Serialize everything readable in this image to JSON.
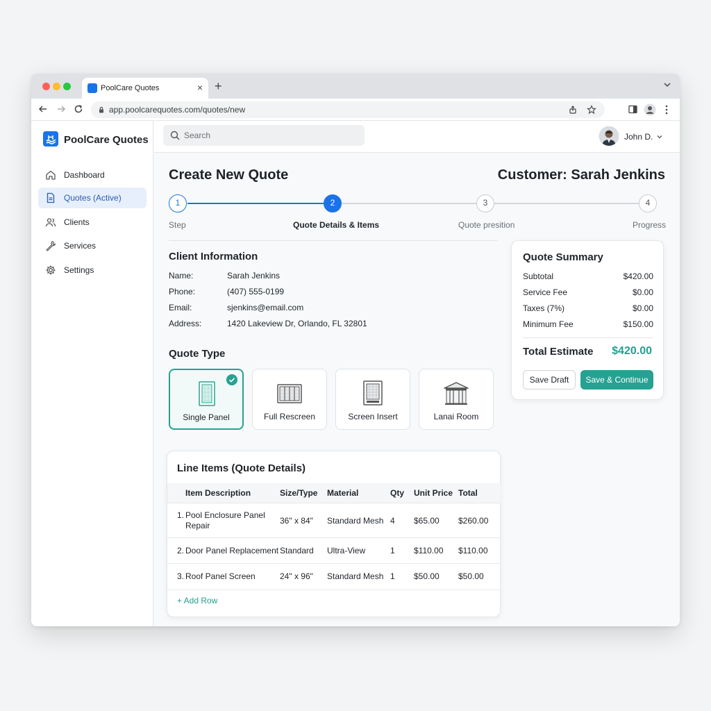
{
  "browser": {
    "tab_title": "PoolCare Quotes",
    "new_tab": "+",
    "url": "app.poolcarequotes.com/quotes/new"
  },
  "sidebar": {
    "brand": "PoolCare Quotes",
    "items": [
      {
        "label": "Dashboard",
        "icon": "home-icon"
      },
      {
        "label": "Quotes (Active)",
        "icon": "document-icon",
        "active": true
      },
      {
        "label": "Clients",
        "icon": "users-icon"
      },
      {
        "label": "Services",
        "icon": "wrench-icon"
      },
      {
        "label": "Settings",
        "icon": "gear-icon"
      }
    ]
  },
  "topbar": {
    "search_placeholder": "Search",
    "user_name": "John D."
  },
  "page": {
    "title": "Create New Quote",
    "customer": "Customer: Sarah Jenkins"
  },
  "stepper": {
    "current": 2,
    "steps": [
      {
        "number": "1",
        "label": "Step"
      },
      {
        "number": "2",
        "label": "Quote Details & Items"
      },
      {
        "number": "3",
        "label": "Quote presition"
      },
      {
        "number": "4",
        "label": "Progress"
      }
    ]
  },
  "client_info": {
    "title": "Client Information",
    "rows": [
      {
        "key": "Name:",
        "value": "Sarah Jenkins"
      },
      {
        "key": "Phone:",
        "value": "(407) 555-0199"
      },
      {
        "key": "Email:",
        "value": "sjenkins@email.com"
      },
      {
        "key": "Address:",
        "value": "1420 Lakeview Dr, Orlando, FL 32801"
      }
    ]
  },
  "quote_type": {
    "title": "Quote Type",
    "selected": "Single Panel",
    "options": [
      {
        "label": "Single Panel",
        "icon": "single-panel-icon"
      },
      {
        "label": "Full Rescreen",
        "icon": "full-rescreen-icon"
      },
      {
        "label": "Screen Insert",
        "icon": "screen-insert-icon"
      },
      {
        "label": "Lanai Room",
        "icon": "lanai-room-icon"
      }
    ]
  },
  "summary": {
    "title": "Quote Summary",
    "rows": [
      {
        "key": "Subtotal",
        "value": "$420.00"
      },
      {
        "key": "Service Fee",
        "value": "$0.00"
      },
      {
        "key": "Taxes (7%)",
        "value": "$0.00"
      },
      {
        "key": "Minimum Fee",
        "value": "$150.00"
      }
    ],
    "total_label": "Total Estimate",
    "total_value": "$420.00",
    "save_draft": "Save Draft",
    "save_continue": "Save & Continue"
  },
  "line_items": {
    "title": "Line Items (Quote Details)",
    "columns": [
      "Item Description",
      "Size/Type",
      "Material",
      "Qty",
      "Unit Price",
      "Total"
    ],
    "rows": [
      {
        "num": "1.",
        "desc_line1": "Pool Enclosure Panel",
        "desc_line2": "Repair",
        "size": "36\" x 84\"",
        "material": "Standard Mesh",
        "qty": "4",
        "unit_price": "$65.00",
        "total": "$260.00"
      },
      {
        "num": "2.",
        "desc_line1": "Door Panel Replacement",
        "size": "Standard",
        "material": "Ultra-View",
        "qty": "1",
        "unit_price": "$110.00",
        "total": "$110.00"
      },
      {
        "num": "3.",
        "desc_line1": "Roof Panel Screen",
        "size": "24\" x 96\"",
        "material": "Standard Mesh",
        "qty": "1",
        "unit_price": "$50.00",
        "total": "$50.00"
      }
    ],
    "add_row": "+ Add Row"
  },
  "colors": {
    "accent_blue": "#1a73e8",
    "accent_teal": "#27a192",
    "active_nav_bg": "#e6effb"
  }
}
